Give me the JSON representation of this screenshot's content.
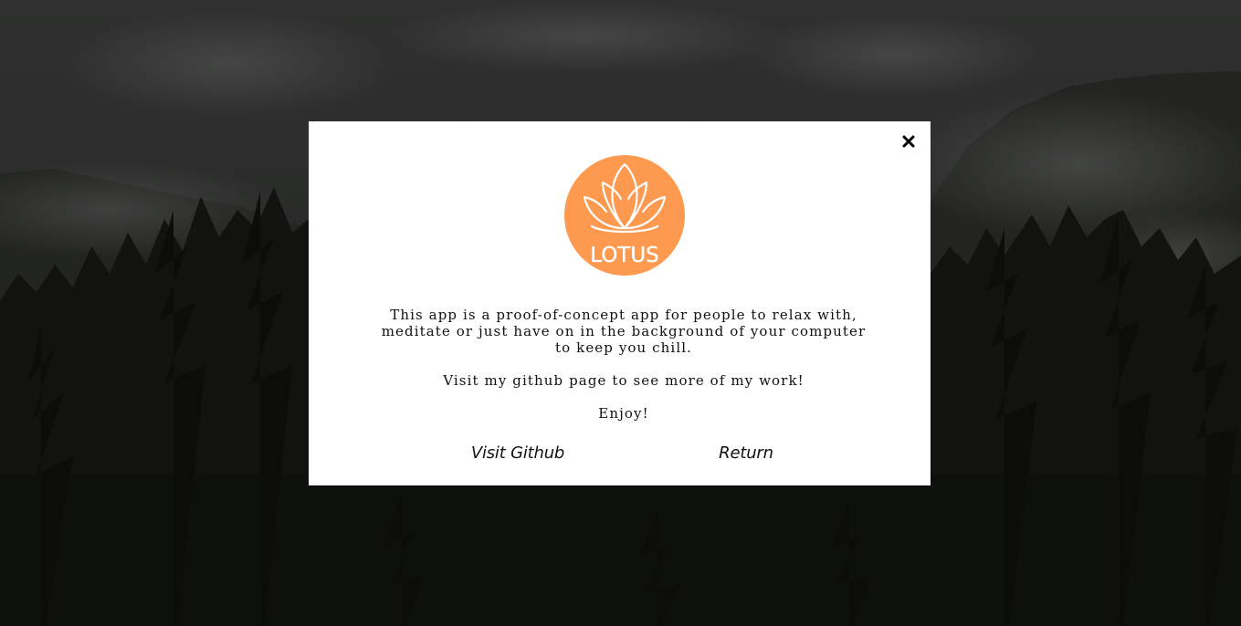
{
  "modal": {
    "logo_text": "LOTUS",
    "description": {
      "line1": "This app is a proof-of-concept app for people to relax with,",
      "line2": "meditate or just have on in the background of your computer",
      "line3": "to keep you chill.",
      "github_note": "Visit my github page to see more of my work!",
      "enjoy": "Enjoy!"
    },
    "buttons": {
      "github_label": "Visit Github",
      "return_label": "Return"
    },
    "close_icon": "close-icon"
  },
  "colors": {
    "logo_orange": "#fd9a50",
    "modal_bg": "#ffffff",
    "text": "#111111"
  }
}
